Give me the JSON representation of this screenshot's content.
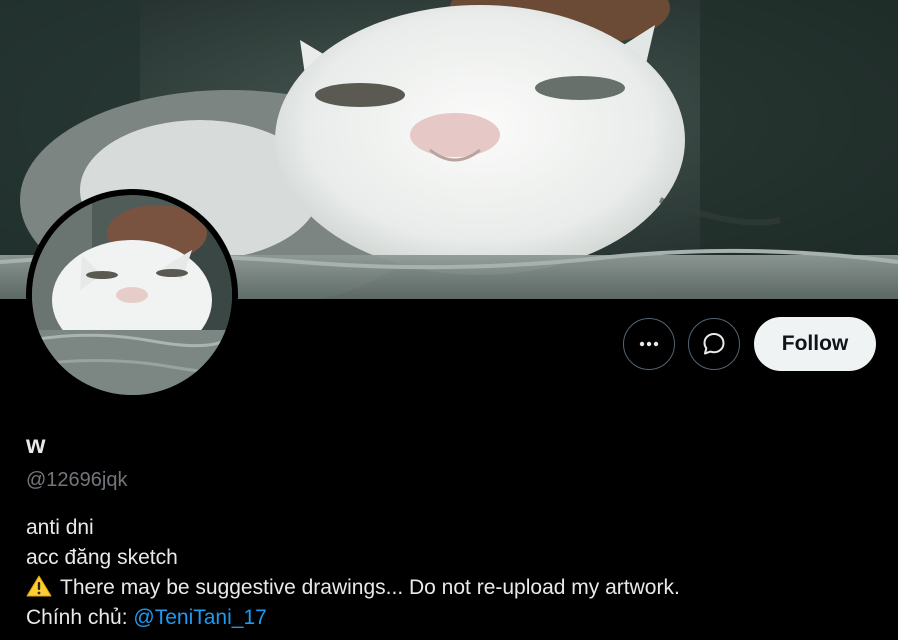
{
  "profile": {
    "display_name": "w",
    "handle": "@12696jqk"
  },
  "actions": {
    "more_icon": "more-horizontal-icon",
    "message_icon": "message-bubble-icon",
    "follow_label": "Follow"
  },
  "bio": {
    "line1": "anti dni",
    "line2": "acc đăng sketch",
    "line3_icon": "warning-icon",
    "line3": "There may be suggestive drawings... Do not re-upload my artwork.",
    "line4_prefix": "Chính chủ: ",
    "line4_mention": "@TeniTani_17"
  },
  "colors": {
    "background": "#000000",
    "text_primary": "#e7e9ea",
    "text_secondary": "#71767b",
    "link": "#1d9bf0",
    "follow_button_bg": "#eff3f4",
    "follow_button_text": "#0f1419",
    "outline": "#536471"
  }
}
